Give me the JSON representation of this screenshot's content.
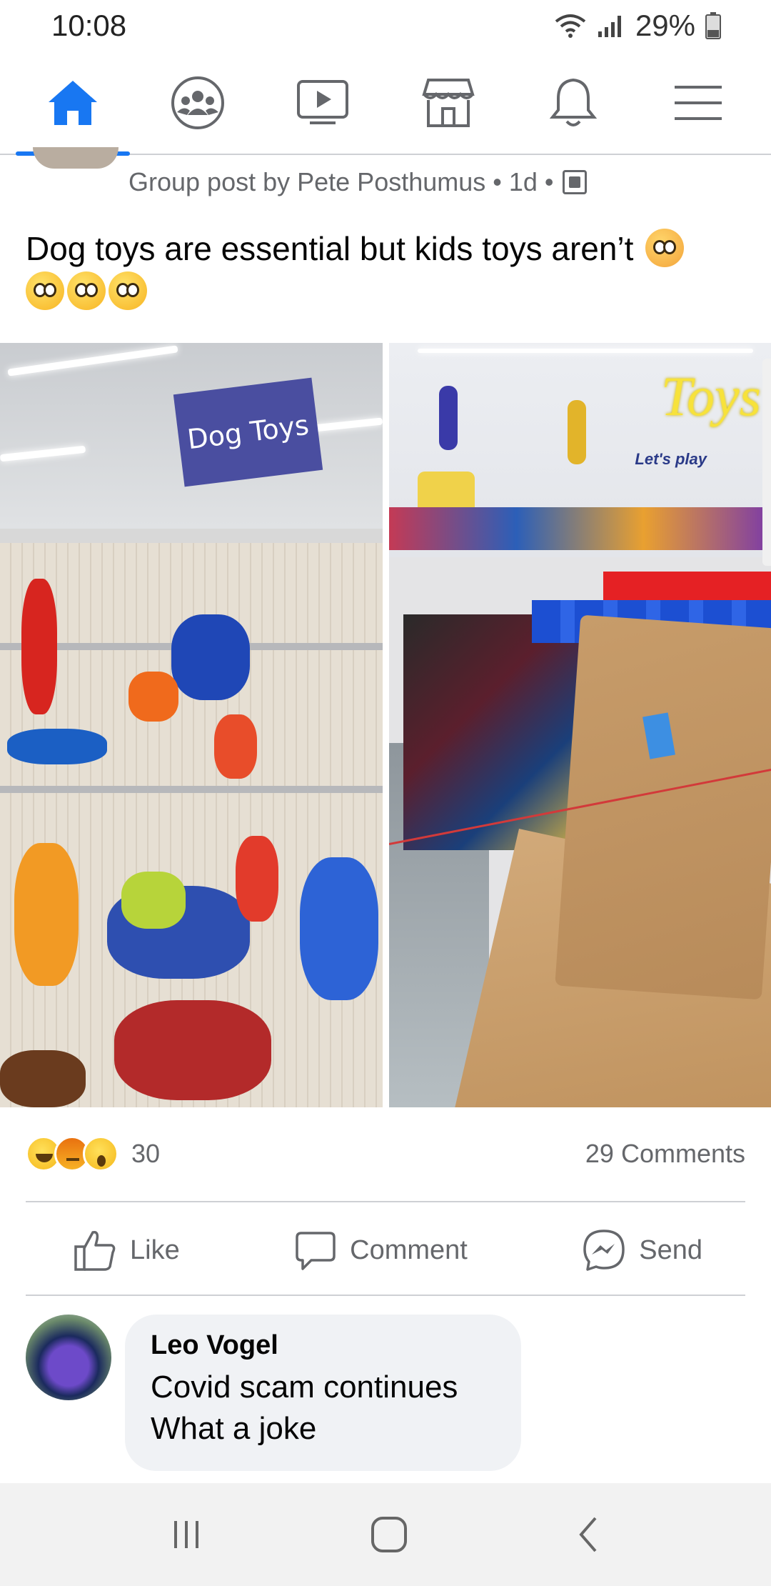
{
  "status_bar": {
    "time": "10:08",
    "battery": "29%"
  },
  "tabs": [
    {
      "icon": "home-icon",
      "active": true
    },
    {
      "icon": "groups-icon",
      "active": false
    },
    {
      "icon": "watch-icon",
      "active": false
    },
    {
      "icon": "marketplace-icon",
      "active": false
    },
    {
      "icon": "notifications-icon",
      "active": false
    },
    {
      "icon": "menu-icon",
      "active": false
    }
  ],
  "post": {
    "meta": "Group post by Pete Posthumus • 1d •",
    "text": "Dog toys are essential but kids toys aren’t",
    "photo_left_sign": "Dog Toys",
    "photo_right_sign": "Toys",
    "photo_right_tagline": "Let's play",
    "reaction_count": "30",
    "comments_count": "29 Comments"
  },
  "actions": {
    "like": "Like",
    "comment": "Comment",
    "send": "Send"
  },
  "comment": {
    "author": "Leo Vogel",
    "text": "Covid scam continues\nWhat a joke"
  },
  "colors": {
    "accent": "#1877f2",
    "secondary_text": "#65676b",
    "bubble": "#f0f2f5"
  }
}
